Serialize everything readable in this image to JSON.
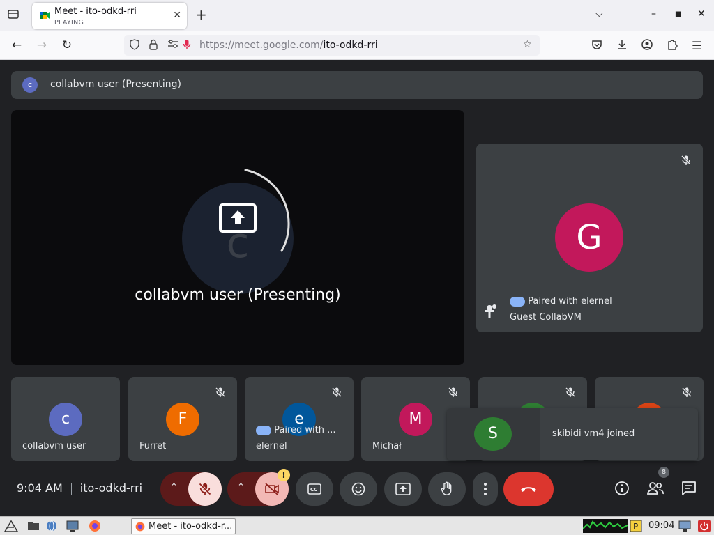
{
  "browser": {
    "tab_title": "Meet - ito-odkd-rri",
    "tab_status": "PLAYING",
    "url_domain": "https://meet.google.com/",
    "url_path": "ito-odkd-rri"
  },
  "meet": {
    "presenting_banner": "collabvm user (Presenting)",
    "presenting_initial": "c",
    "main_presenting_label": "collabvm user (Presenting)",
    "main_initial": "c",
    "side_tile": {
      "initial": "G",
      "paired_text": "Paired with elernel",
      "name": "Guest CollabVM",
      "avatar_color": "#c2185b"
    },
    "participants": [
      {
        "initial": "c",
        "name": "collabvm user",
        "color": "#5c6bc0",
        "muted": false
      },
      {
        "initial": "F",
        "name": "Furret",
        "color": "#ef6c00",
        "muted": true
      },
      {
        "initial": "e",
        "name": "elernel",
        "color": "#01579b",
        "muted": true,
        "paired": "Paired with ..."
      },
      {
        "initial": "M",
        "name": "Michał",
        "color": "#c2185b",
        "muted": true
      }
    ],
    "toast": {
      "initial": "S",
      "text": "skibidi vm4 joined"
    },
    "clock": "9:04 AM",
    "meeting_code": "ito-odkd-rri",
    "people_count": "8"
  },
  "taskbar": {
    "task_title": "Meet - ito-odkd-r...",
    "clock": "09:04"
  }
}
